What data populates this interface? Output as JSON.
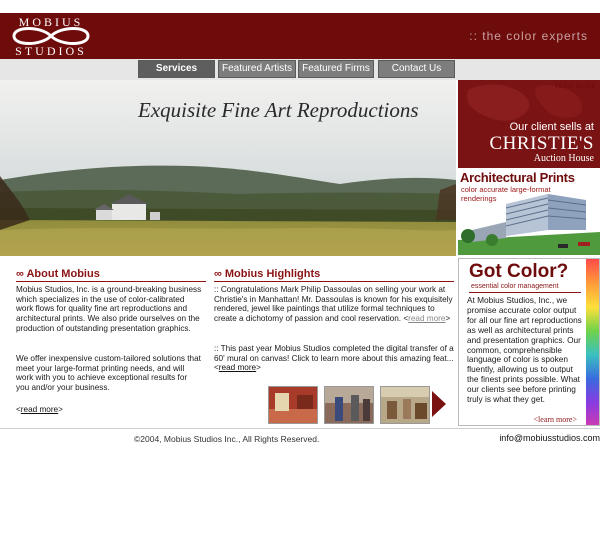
{
  "header": {
    "logo_top": "MOBIUS",
    "logo_bottom": "STUDIOS",
    "tagline": ":: the color experts"
  },
  "nav": {
    "items": [
      "Services",
      "Featured Artists",
      "Featured Firms",
      "Contact Us"
    ],
    "active": "Services"
  },
  "hero": {
    "title": "Exquisite Fine Art Reproductions"
  },
  "sidebar": {
    "read_more": "read more",
    "christies": {
      "line1": "Our client sells at",
      "line2": "CHRISTIE'S",
      "line3": "Auction House"
    },
    "architectural": {
      "title": "Architectural Prints",
      "subtitle": "color accurate large-format renderings"
    },
    "got_color": {
      "title": "Got Color?",
      "subtitle": "essential color management",
      "body": "At Mobius Studios, Inc., we promise accurate color output for all our fine art reproductions as well as architectural prints and presentation graphics. Our common, comprehensible language of color is spoken fluently, allowing us to output the finest prints possible. What our clients see before printing truly is what they get.",
      "more": "<learn more>"
    }
  },
  "about": {
    "title": "∞ About Mobius",
    "p1": "Mobius Studios, Inc. is a ground-breaking business which specializes in the use of color-calibrated work flows for quality fine art reproductions and architectural prints. We also pride ourselves on the production of outstanding presentation graphics.",
    "p2": "We offer inexpensive custom-tailored solutions that meet your large-format printing needs, and will work with you to achieve exceptional results for you and/or your business.",
    "more_open": "<",
    "more_label": "read more",
    "more_close": ">"
  },
  "highlights": {
    "title": "∞ Mobius Highlights",
    "p1_text": ":: Congratulations Mark Philip Dassoulas on selling your work at Christie's in Manhattan! Mr. Dassoulas is known for his exquisitely rendered, jewel like paintings that utilize formal techniques to create a dichotomy of passion and cool reservation. <",
    "p1_more": "read more",
    "p1_close": ">",
    "p2_text": ":: This past year Mobius Studios completed the digital transfer of a 60' mural on canvas! Click to learn more about this amazing feat... <",
    "p2_more": "read more",
    "p2_close": ">"
  },
  "footer": {
    "copyright": "©2004, Mobius Studios Inc., All Rights Reserved.",
    "email": "info@mobiusstudios.com"
  },
  "colors": {
    "brand": "#6e0b0b",
    "accent": "#8a1414",
    "nav": "#7d7d7d"
  }
}
